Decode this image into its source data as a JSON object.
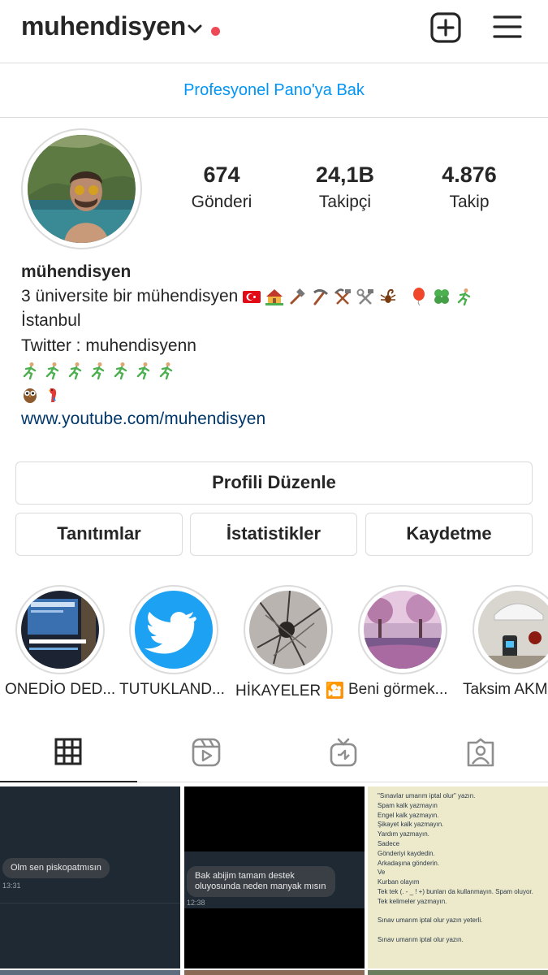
{
  "header": {
    "username": "muhendisyen"
  },
  "pro_dashboard": "Profesyonel Pano'ya Bak",
  "stats": [
    {
      "value": "674",
      "label": "Gönderi"
    },
    {
      "value": "24,1B",
      "label": "Takipçi"
    },
    {
      "value": "4.876",
      "label": "Takip"
    }
  ],
  "bio": {
    "name": "mühendisyen",
    "line1": "3 üniversite bir mühendisyen",
    "line2": "İstanbul",
    "line3": "Twitter : muhendisyenn",
    "link": "www.youtube.com/muhendisyen"
  },
  "buttons": {
    "edit_profile": "Profili Düzenle",
    "promotions": "Tanıtımlar",
    "insights": "İstatistikler",
    "saved": "Kaydetme"
  },
  "highlights": [
    {
      "label": "ONEDİO DED..."
    },
    {
      "label": "TUTUKLAND..."
    },
    {
      "label": "HİKAYELER 🎦"
    },
    {
      "label": "Beni görmek..."
    },
    {
      "label": "Taksim AKM"
    }
  ],
  "tabs": [
    {
      "icon": "grid-icon"
    },
    {
      "icon": "reels-icon"
    },
    {
      "icon": "igtv-icon"
    },
    {
      "icon": "tagged-icon"
    }
  ],
  "posts": [
    {
      "message": "Olm sen piskopatmısın",
      "time": "13:31"
    },
    {
      "message": "Bak abijim tamam destek oluyosunda neden manyak mısın",
      "time": "12:38"
    },
    {
      "note_lines": [
        "\"Sınavlar umarım iptal olur\" yazın.",
        "Spam kalk yazmayın",
        "Engel kalk yazmayın.",
        "Şikayet kalk yazmayın.",
        "Yardım yazmayın.",
        "Sadece",
        "Gönderiyi kaydedin.",
        "Arkadaşına gönderin.",
        "Ve",
        "Kurban olayım",
        "Tek tek  (. - _ ! +) bunları da kullanmayın. Spam oluyor.",
        "Tek kelimeler yazmayın.",
        "",
        "Sınav umarım iptal olur yazın yeterli.",
        "",
        "Sınav umarım iptal olur yazın."
      ]
    }
  ],
  "colors": {
    "accent": "#0095f6",
    "link": "#00376b",
    "notification_dot": "#ed4956",
    "border": "#dbdbdb",
    "twitter_blue": "#1da1f2"
  }
}
